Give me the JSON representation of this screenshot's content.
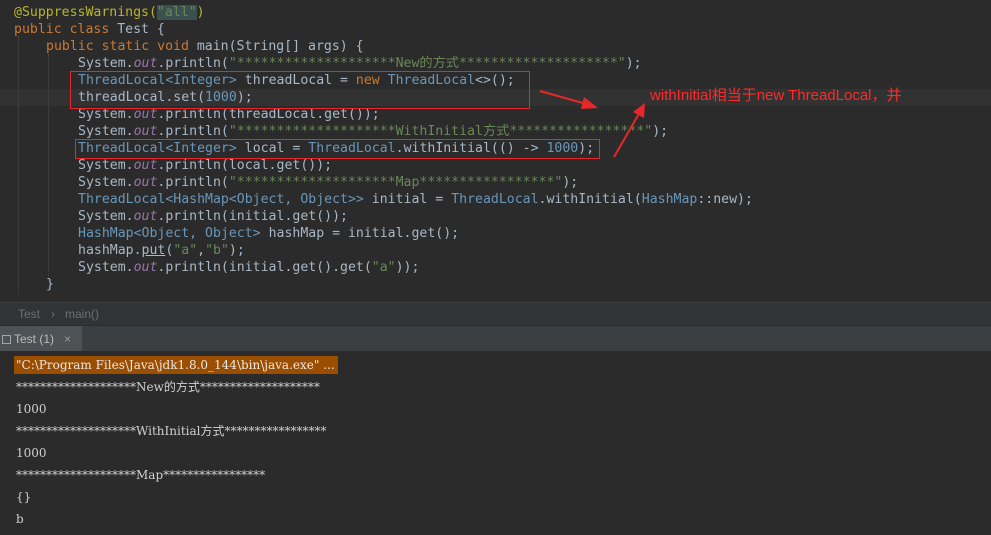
{
  "code": {
    "annotation": "@SuppressWarnings(",
    "annotation_arg": "\"all\"",
    "annotation_end": ")",
    "l2": [
      "public class ",
      "Test {"
    ],
    "l3": [
      "public static void ",
      "main(String[] args) {"
    ],
    "l4": [
      "System.",
      "out",
      ".println(",
      "\"********************New的方式********************\"",
      ");"
    ],
    "l5": [
      "ThreadLocal",
      "<Integer>",
      " threadLocal = ",
      "new ",
      "ThreadLocal",
      "<>();"
    ],
    "l6": [
      "threadLocal.set(",
      "1000",
      ");"
    ],
    "l7": [
      "System.",
      "out",
      ".println(threadLocal.get());"
    ],
    "l8": [
      "System.",
      "out",
      ".println(",
      "\"********************WithInitial方式*****************\"",
      ");"
    ],
    "l9": [
      "ThreadLocal",
      "<Integer>",
      " local = ",
      "ThreadLocal",
      ".withInitial(() -> ",
      "1000",
      ");"
    ],
    "l10": [
      "System.",
      "out",
      ".println(local.get());"
    ],
    "l11": [
      "System.",
      "out",
      ".println(",
      "\"********************Map*****************\"",
      ");"
    ],
    "l12": [
      "ThreadLocal",
      "<HashMap<Object, Object>>",
      " initial = ",
      "ThreadLocal",
      ".withInitial(",
      "HashMap",
      "::new);"
    ],
    "l13": [
      "System.",
      "out",
      ".println(initial.get());"
    ],
    "l14": [
      "HashMap",
      "<Object, Object>",
      " hashMap = initial.get();"
    ],
    "l15": [
      "hashMap.",
      "put",
      "(",
      "\"a\"",
      ",",
      "\"b\"",
      ");"
    ],
    "l16": [
      "System.",
      "out",
      ".println(initial.get().get(",
      "\"a\"",
      "));"
    ],
    "l17": "}"
  },
  "note": "withInitial相当于new ThreadLocal，并",
  "breadcrumb": {
    "class": "Test",
    "sep": "›",
    "method": "main()"
  },
  "run_tab": {
    "label": "Test (1)",
    "close": "×"
  },
  "console": [
    "\"C:\\Program Files\\Java\\jdk1.8.0_144\\bin\\java.exe\" ...",
    "********************New的方式********************",
    "1000",
    "********************WithInitial方式*****************",
    "1000",
    "********************Map*****************",
    "{}",
    "b"
  ],
  "colors": {
    "keyword": "#cc7832",
    "string": "#6a8759",
    "number": "#6897bb",
    "annotation_red": "#ff2a2a"
  }
}
